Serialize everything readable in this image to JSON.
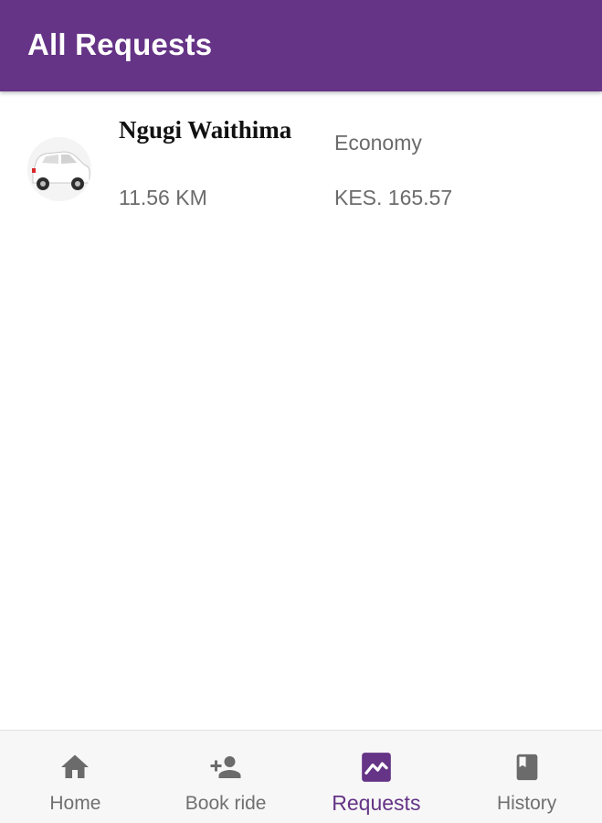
{
  "appbar": {
    "title": "All Requests",
    "color": "#653486"
  },
  "requests": [
    {
      "name": "Ngugi Waithima",
      "distance": "11.56 KM",
      "category": "Economy",
      "fare": "KES. 165.57",
      "avatar_icon": "car-icon"
    }
  ],
  "bottom_nav": {
    "active_color": "#653486",
    "inactive_color": "#707070",
    "items": [
      {
        "label": "Home",
        "icon": "home-icon",
        "active": false
      },
      {
        "label": "Book ride",
        "icon": "person-add-icon",
        "active": false
      },
      {
        "label": "Requests",
        "icon": "chart-icon",
        "active": true
      },
      {
        "label": "History",
        "icon": "book-icon",
        "active": false
      }
    ]
  }
}
